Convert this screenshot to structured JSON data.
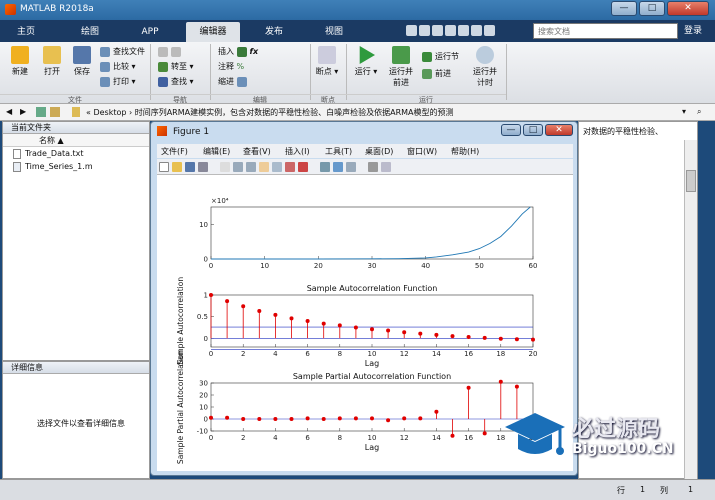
{
  "app": {
    "title": "MATLAB R2018a",
    "window_controls": [
      "—",
      "□",
      "✕"
    ]
  },
  "tabs": [
    "主页",
    "绘图",
    "APP",
    "编辑器",
    "发布",
    "视图"
  ],
  "search": {
    "placeholder": "搜索文档"
  },
  "help_label": "登录",
  "ribbon": {
    "file": {
      "new": "新建",
      "open": "打开",
      "save": "保存",
      "find_files": "查找文件",
      "compare": "比较",
      "print": "打印",
      "group": "文件"
    },
    "navigate": {
      "goto": "转至",
      "find": "查找",
      "group": "导航"
    },
    "edit": {
      "insert": "插入",
      "comment": "注释",
      "indent": "缩进",
      "group": "编辑"
    },
    "breakpoints": {
      "label": "断点",
      "group": "断点"
    },
    "run": {
      "run": "运行",
      "run_advance": "运行并\n前进",
      "run_section": "运行节",
      "advance": "前进",
      "run_time": "运行并\n计时",
      "group": "运行"
    }
  },
  "addressbar": {
    "path": "« Desktop › 时间序列ARMA建模实例，包含对数据的平稳性检验、白噪声检验及依据ARMA模型的预测",
    "current_folder_label": "当前文件夹"
  },
  "files": {
    "header": "名称 ▲",
    "items": [
      "Trade_Data.txt",
      "Time_Series_1.m"
    ]
  },
  "details": {
    "title": "详细信息",
    "message": "选择文件以查看详细信息"
  },
  "right_panel_text": "对数据的平稳性检验、",
  "status": {
    "row_label": "行",
    "row": "1",
    "col_label": "列",
    "col": "1"
  },
  "figure": {
    "title": "Figure 1",
    "menu": [
      "文件(F)",
      "编辑(E)",
      "查看(V)",
      "插入(I)",
      "工具(T)",
      "桌面(D)",
      "窗口(W)",
      "帮助(H)"
    ]
  },
  "watermark": {
    "line1": "必过源码",
    "line2": "Biguo100.CN"
  },
  "chart_data": [
    {
      "type": "line",
      "title": "",
      "xlabel": "",
      "ylabel": "",
      "exponent_label": "×10⁴",
      "xlim": [
        0,
        60
      ],
      "ylim": [
        0,
        15
      ],
      "xticks": [
        0,
        10,
        20,
        30,
        40,
        50,
        60
      ],
      "yticks": [
        0,
        10
      ],
      "x": [
        0,
        10,
        20,
        30,
        35,
        40,
        42,
        45,
        48,
        50,
        52,
        54,
        56,
        58,
        59.5
      ],
      "values": [
        0,
        0,
        0,
        0.05,
        0.1,
        0.3,
        0.6,
        1.2,
        2.0,
        3.0,
        4.5,
        6.5,
        9.5,
        13,
        15
      ],
      "color": "#1f77b4"
    },
    {
      "type": "stem",
      "title": "Sample Autocorrelation Function",
      "xlabel": "Lag",
      "ylabel": "Sample Autocorrelation",
      "xlim": [
        0,
        20
      ],
      "ylim": [
        -0.2,
        1
      ],
      "xticks": [
        0,
        2,
        4,
        6,
        8,
        10,
        12,
        14,
        16,
        18,
        20
      ],
      "yticks": [
        -0.5,
        0,
        0.5,
        1
      ],
      "x": [
        0,
        1,
        2,
        3,
        4,
        5,
        6,
        7,
        8,
        9,
        10,
        11,
        12,
        13,
        14,
        15,
        16,
        17,
        18,
        19,
        20
      ],
      "values": [
        1,
        0.86,
        0.74,
        0.63,
        0.54,
        0.46,
        0.4,
        0.34,
        0.3,
        0.25,
        0.21,
        0.18,
        0.14,
        0.11,
        0.08,
        0.05,
        0.03,
        0.01,
        -0.01,
        -0.02,
        -0.03
      ],
      "bounds": [
        0.26,
        -0.26
      ],
      "color": "#e00000"
    },
    {
      "type": "stem",
      "title": "Sample Partial Autocorrelation Function",
      "xlabel": "Lag",
      "ylabel": "Sample Partial Autocorrelation",
      "xlim": [
        0,
        20
      ],
      "ylim": [
        -10,
        30
      ],
      "xticks": [
        0,
        2,
        4,
        6,
        8,
        10,
        12,
        14,
        16,
        18,
        20
      ],
      "yticks": [
        -10,
        0,
        10,
        20,
        30
      ],
      "x": [
        0,
        1,
        2,
        3,
        4,
        5,
        6,
        7,
        8,
        9,
        10,
        11,
        12,
        13,
        14,
        15,
        16,
        17,
        18,
        19,
        20
      ],
      "values": [
        1,
        1,
        0,
        0,
        0,
        0,
        0.5,
        0,
        0.5,
        0.5,
        0.5,
        -1,
        0.5,
        0.5,
        6,
        -14,
        26,
        -12,
        31,
        27,
        -4
      ],
      "color": "#e00000"
    }
  ]
}
